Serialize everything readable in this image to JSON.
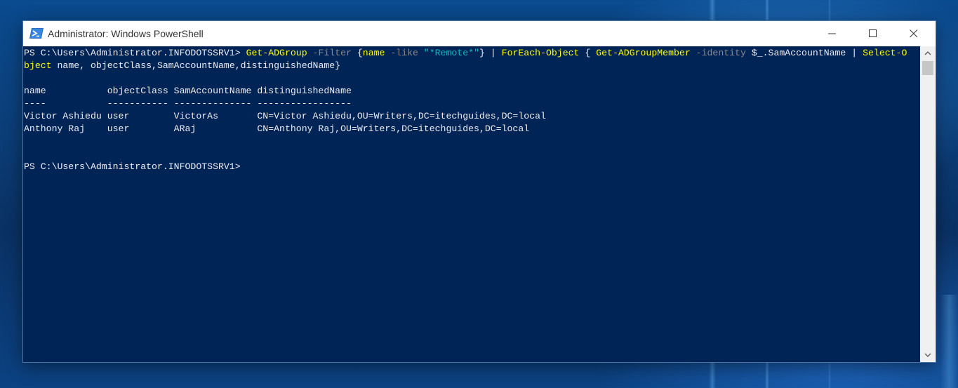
{
  "window": {
    "title": "Administrator: Windows PowerShell",
    "icon": "powershell-icon",
    "controls": [
      "minimize-icon",
      "maximize-icon",
      "close-icon"
    ]
  },
  "console": {
    "colors": {
      "background": "#012456",
      "text": "#eeedf0",
      "command": "#ffff00",
      "parameter": "#8b8b8b",
      "string": "#00bfbf"
    },
    "line1": {
      "prompt": "PS C:\\Users\\Administrator.INFODOTSSRV1> ",
      "cmd1": "Get-ADGroup",
      "param_filter": " -Filter ",
      "brace_open": "{",
      "name": "name",
      "op_like": " -like ",
      "str_remote": "\"*Remote*\"",
      "brace_close": "}",
      "pipe1": " | ",
      "cmd2": "ForEach-Object",
      "brace2_open": " { ",
      "cmd3": "Get-ADGroupMember",
      "param_identity": " -identity ",
      "var": "$_",
      "prop": ".SamAccountName",
      "pipe2": " | ",
      "cmd4_part": "Select-O"
    },
    "line2": {
      "cmd4_rest": "bject",
      "args": " name, objectClass,SamAccountName,distinguishedName}"
    },
    "table": {
      "header": "name           objectClass SamAccountName distinguishedName",
      "separator": "----           ----------- -------------- -----------------",
      "rows": [
        "Victor Ashiedu user        VictorAs       CN=Victor Ashiedu,OU=Writers,DC=itechguides,DC=local",
        "Anthony Raj    user        ARaj           CN=Anthony Raj,OU=Writers,DC=itechguides,DC=local"
      ]
    },
    "final_prompt": "PS C:\\Users\\Administrator.INFODOTSSRV1>"
  },
  "scrollbar": {
    "up_icon": "chevron-up-icon",
    "down_icon": "chevron-down-icon"
  }
}
